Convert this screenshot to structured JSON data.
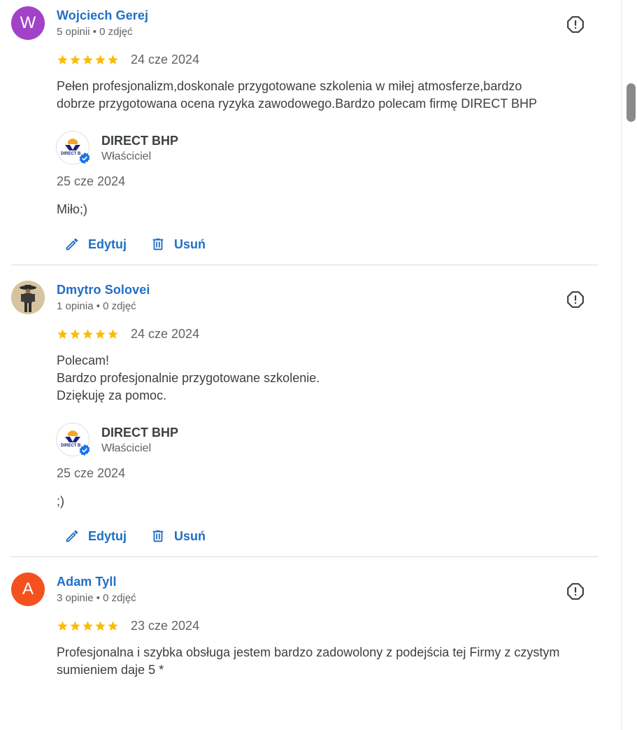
{
  "reviews": [
    {
      "name": "Wojciech Gerej",
      "avatar_letter": "W",
      "avatar_color": "#a142c9",
      "meta": "5 opinii • 0 zdjęć",
      "stars": 5,
      "date": "24 cze 2024",
      "text_lines": [
        "Pełen profesjonalizm,doskonale przygotowane szkolenia w miłej atmosferze,bardzo",
        "dobrze przygotowana ocena ryzyka zawodowego.Bardzo polecam firmę DIRECT BHP"
      ],
      "reply": {
        "owner_name": "DIRECT BHP",
        "owner_role": "Właściciel",
        "logo_text": "DIRECT B",
        "date": "25 cze 2024",
        "text": "Miło;)"
      },
      "actions": {
        "edit": "Edytuj",
        "delete": "Usuń"
      }
    },
    {
      "name": "Dmytro Solovei",
      "avatar_letter": "",
      "avatar_color": "#d9c9a8",
      "meta": "1 opinia • 0 zdjęć",
      "stars": 5,
      "date": "24 cze 2024",
      "text_lines": [
        "Polecam!",
        "Bardzo profesjonalnie przygotowane szkolenie.",
        "Dziękuję za pomoc."
      ],
      "reply": {
        "owner_name": "DIRECT BHP",
        "owner_role": "Właściciel",
        "logo_text": "DIRECT B",
        "date": "25 cze 2024",
        "text": ";)"
      },
      "actions": {
        "edit": "Edytuj",
        "delete": "Usuń"
      }
    },
    {
      "name": "Adam Tyll",
      "avatar_letter": "A",
      "avatar_color": "#f4511e",
      "meta": "3 opinie • 0 zdjęć",
      "stars": 5,
      "date": "23 cze 2024",
      "text_lines": [
        "Profesjonalna i szybka obsługa jestem bardzo zadowolony z podejścia tej Firmy z czystym",
        "sumieniem daje 5 *"
      ]
    }
  ],
  "colors": {
    "link_blue": "#1f6fc5",
    "star_yellow": "#fbbc04",
    "verified_blue": "#1a73e8",
    "muted_text": "#5f6368"
  },
  "icons": {
    "flag": "report-icon",
    "edit": "pencil-icon",
    "delete": "trash-icon",
    "verified": "verified-badge-icon",
    "star": "star-icon"
  }
}
